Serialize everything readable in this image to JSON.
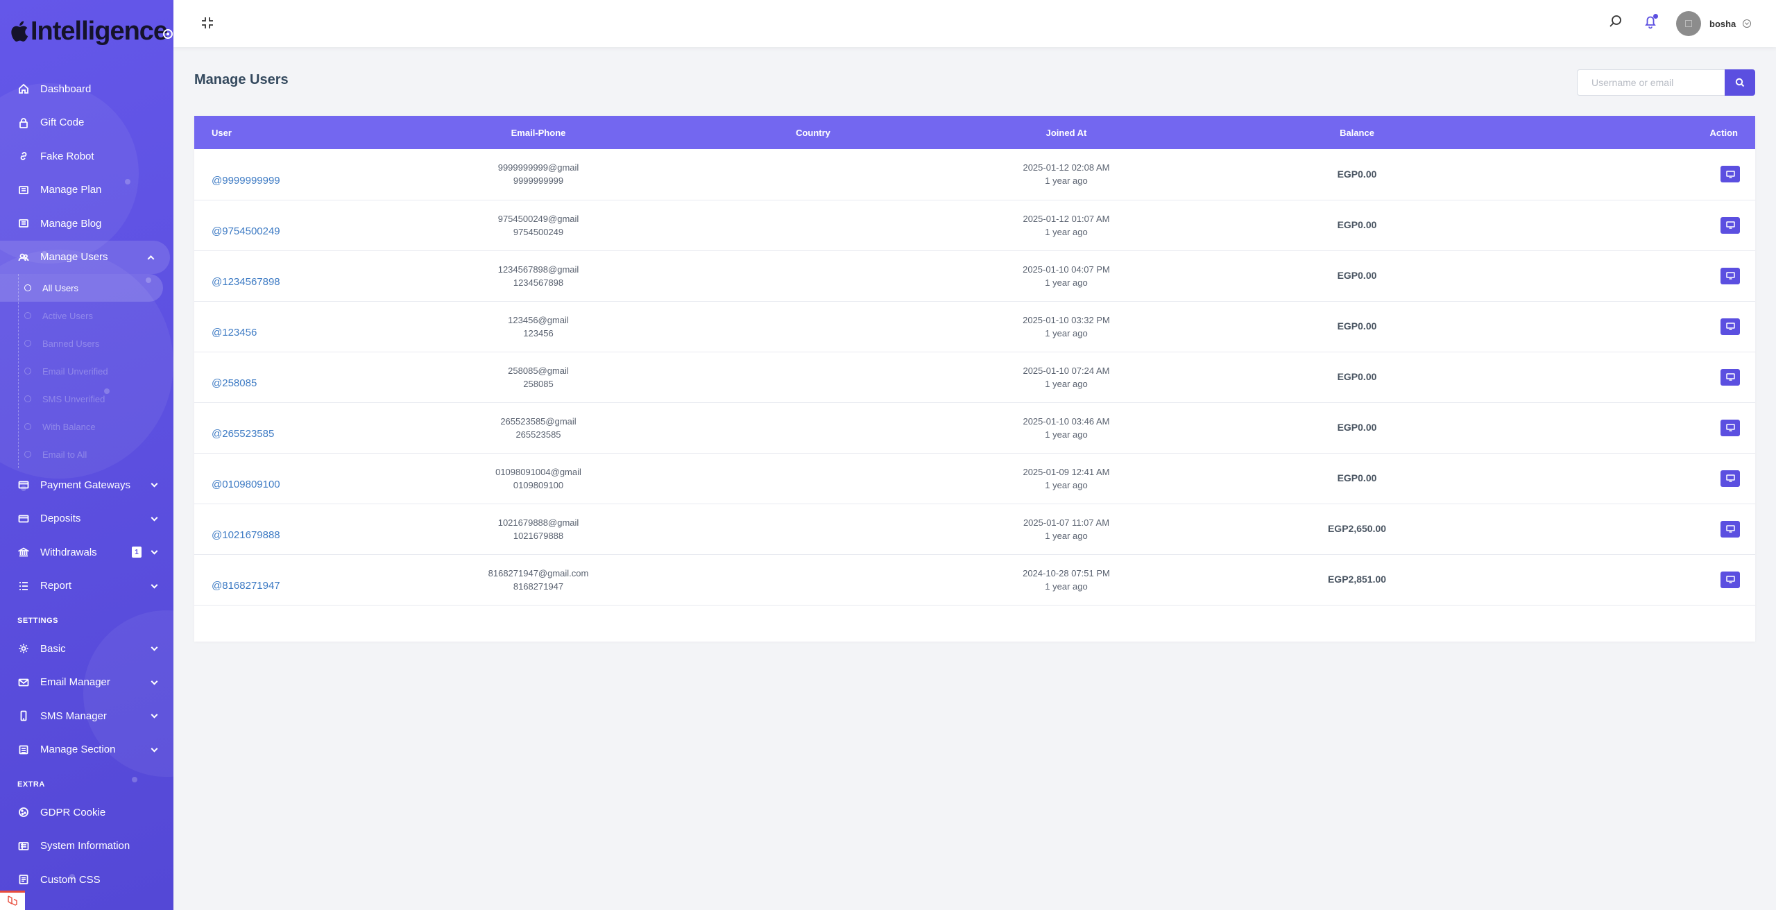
{
  "brand": {
    "name": "Intelligence",
    "logo_icon": "apple-icon"
  },
  "sidebar": {
    "items": [
      {
        "label": "Dashboard",
        "icon": "home-icon"
      },
      {
        "label": "Gift Code",
        "icon": "lock-icon"
      },
      {
        "label": "Fake Robot",
        "icon": "link-icon"
      },
      {
        "label": "Manage Plan",
        "icon": "list-icon"
      },
      {
        "label": "Manage Blog",
        "icon": "list-icon"
      },
      {
        "label": "Manage Users",
        "icon": "users-icon"
      }
    ],
    "users_submenu": [
      {
        "label": "All Users"
      },
      {
        "label": "Active Users"
      },
      {
        "label": "Banned Users"
      },
      {
        "label": "Email Unverified"
      },
      {
        "label": "SMS Unverified"
      },
      {
        "label": "With Balance"
      },
      {
        "label": "Email to All"
      }
    ],
    "items_after": [
      {
        "label": "Payment Gateways",
        "icon": "credit-card-icon"
      },
      {
        "label": "Deposits",
        "icon": "credit-card-icon"
      },
      {
        "label": "Withdrawals",
        "icon": "bank-icon",
        "badge": "1"
      },
      {
        "label": "Report",
        "icon": "list-icon"
      }
    ],
    "settings_label": "SETTINGS",
    "settings_items": [
      {
        "label": "Basic",
        "icon": "gear-icon"
      },
      {
        "label": "Email Manager",
        "icon": "envelope-icon"
      },
      {
        "label": "SMS Manager",
        "icon": "mobile-icon"
      },
      {
        "label": "Manage Section",
        "icon": "list-icon"
      }
    ],
    "extra_label": "EXTRA",
    "extra_items": [
      {
        "label": "GDPR Cookie",
        "icon": "cookie-icon"
      },
      {
        "label": "System Information",
        "icon": "server-icon"
      },
      {
        "label": "Custom CSS",
        "icon": "code-icon"
      }
    ]
  },
  "topbar": {
    "username": "bosha"
  },
  "main": {
    "title": "Manage Users",
    "search_placeholder": "Username or email"
  },
  "table": {
    "headers": [
      "User",
      "Email-Phone",
      "Country",
      "Joined At",
      "Balance",
      "Action"
    ],
    "rows": [
      {
        "user": "@9999999999",
        "email": "9999999999@gmail",
        "phone": "9999999999",
        "country": "",
        "joined": "2025-01-12 02:08 AM",
        "ago": "1 year ago",
        "balance": "EGP0.00"
      },
      {
        "user": "@9754500249",
        "email": "9754500249@gmail",
        "phone": "9754500249",
        "country": "",
        "joined": "2025-01-12 01:07 AM",
        "ago": "1 year ago",
        "balance": "EGP0.00"
      },
      {
        "user": "@1234567898",
        "email": "1234567898@gmail",
        "phone": "1234567898",
        "country": "",
        "joined": "2025-01-10 04:07 PM",
        "ago": "1 year ago",
        "balance": "EGP0.00"
      },
      {
        "user": "@123456",
        "email": "123456@gmail",
        "phone": "123456",
        "country": "",
        "joined": "2025-01-10 03:32 PM",
        "ago": "1 year ago",
        "balance": "EGP0.00"
      },
      {
        "user": "@258085",
        "email": "258085@gmail",
        "phone": "258085",
        "country": "",
        "joined": "2025-01-10 07:24 AM",
        "ago": "1 year ago",
        "balance": "EGP0.00"
      },
      {
        "user": "@265523585",
        "email": "265523585@gmail",
        "phone": "265523585",
        "country": "",
        "joined": "2025-01-10 03:46 AM",
        "ago": "1 year ago",
        "balance": "EGP0.00"
      },
      {
        "user": "@0109809100",
        "email": "01098091004@gmail",
        "phone": "0109809100",
        "country": "",
        "joined": "2025-01-09 12:41 AM",
        "ago": "1 year ago",
        "balance": "EGP0.00"
      },
      {
        "user": "@1021679888",
        "email": "1021679888@gmail",
        "phone": "1021679888",
        "country": "",
        "joined": "2025-01-07 11:07 AM",
        "ago": "1 year ago",
        "balance": "EGP2,650.00"
      },
      {
        "user": "@8168271947",
        "email": "8168271947@gmail.com",
        "phone": "8168271947",
        "country": "",
        "joined": "2024-10-28 07:51 PM",
        "ago": "1 year ago",
        "balance": "EGP2,851.00"
      }
    ]
  },
  "colors": {
    "accent": "#5b4fe0",
    "table_header": "#7367f0",
    "link": "#3e7bc4",
    "background": "#f3f4f7"
  }
}
